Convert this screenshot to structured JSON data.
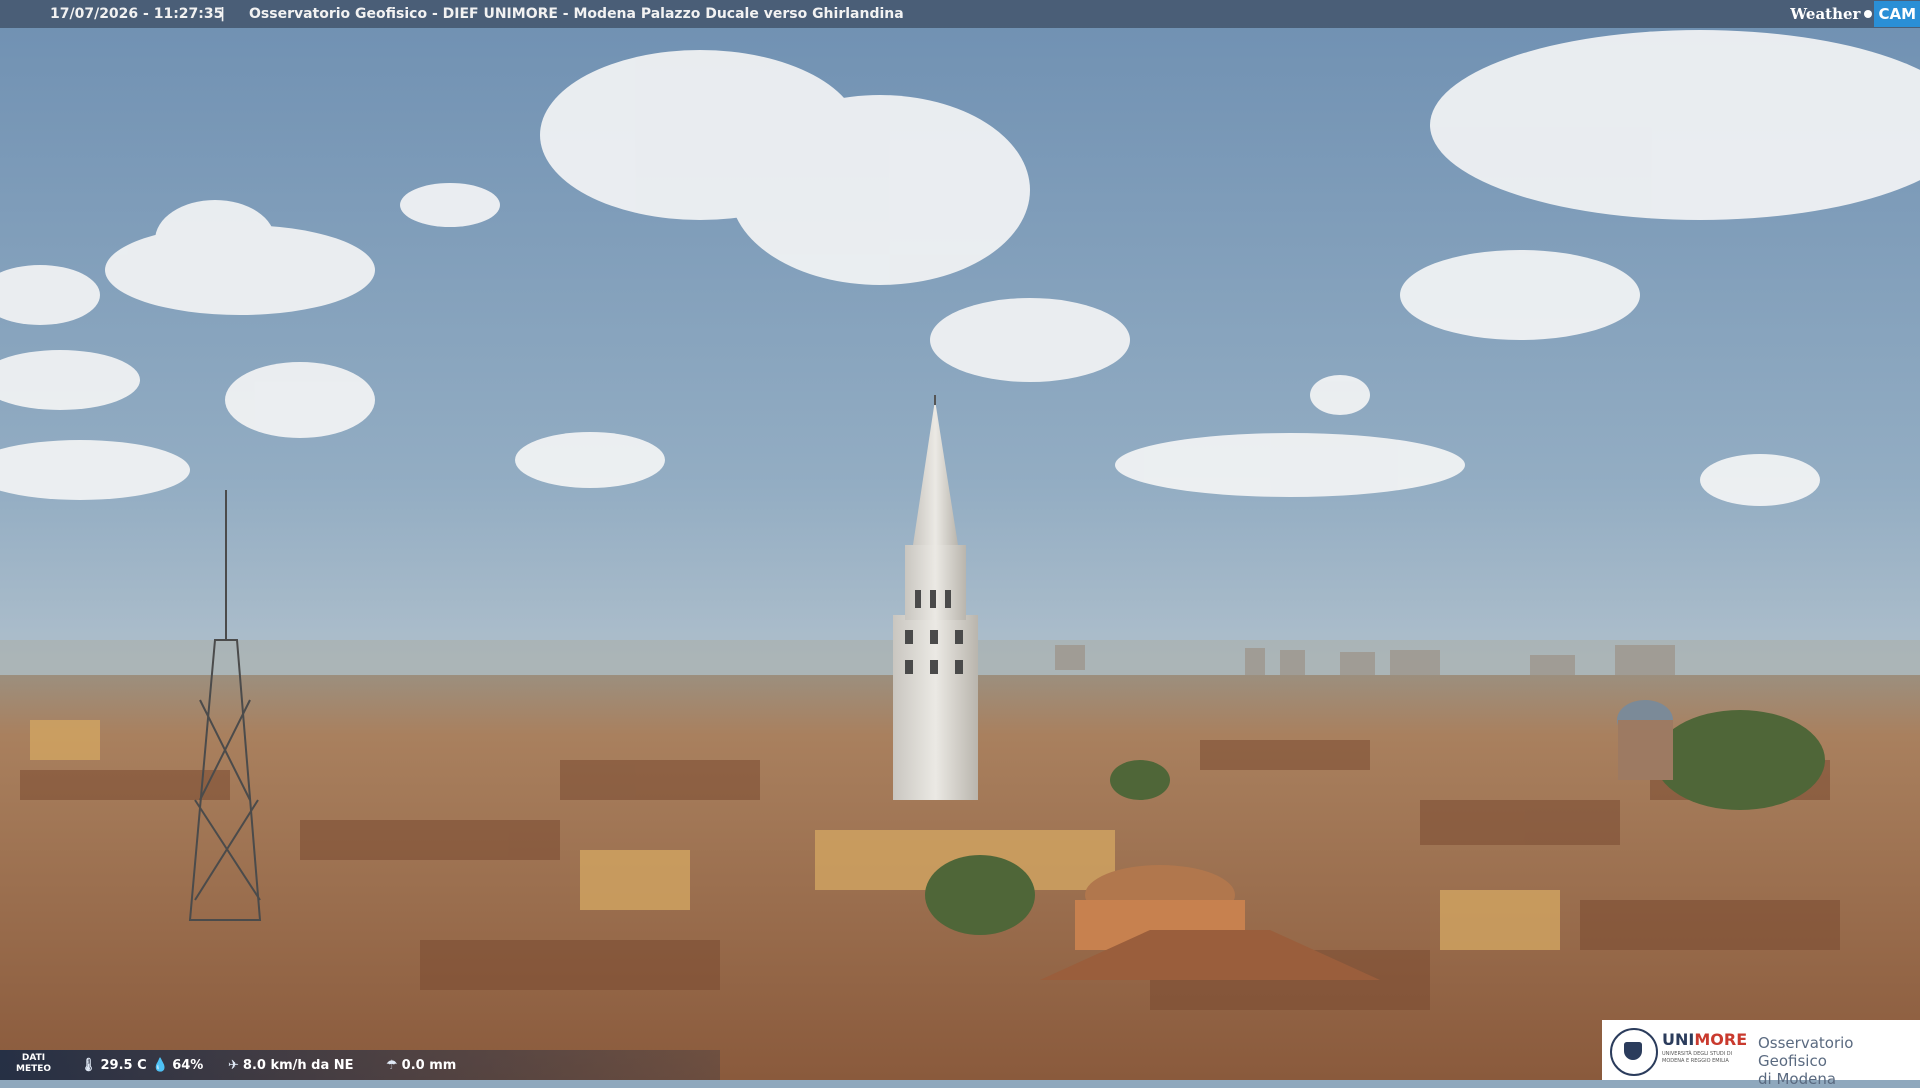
{
  "header": {
    "timestamp": "17/07/2026 - 11:27:35",
    "separator": "|",
    "title": "Osservatorio Geofisico - DIEF UNIMORE - Modena Palazzo Ducale verso Ghirlandina"
  },
  "brand": {
    "weather": "Weather",
    "cam": "CAM"
  },
  "meteo": {
    "label_line1": "DATI",
    "label_line2": "METEO",
    "temperature": "29.5 C",
    "humidity": "64%",
    "wind": "8.0 km/h da NE",
    "rain": "0.0 mm",
    "icons": [
      "thermometer-icon",
      "humidity-icon",
      "wind-icon",
      "rain-icon"
    ]
  },
  "logo": {
    "uni": "UNI",
    "more": "MORE",
    "university_line": "UNIVERSITÀ DEGLI STUDI DI MODENA E REGGIO EMILIA",
    "observatory_line1": "Osservatorio Geofisico",
    "observatory_line2": "di Modena"
  },
  "colors": {
    "brand_blue": "#2a8fd6",
    "unimore_red": "#c93a2e",
    "unimore_navy": "#2b3c5c"
  }
}
